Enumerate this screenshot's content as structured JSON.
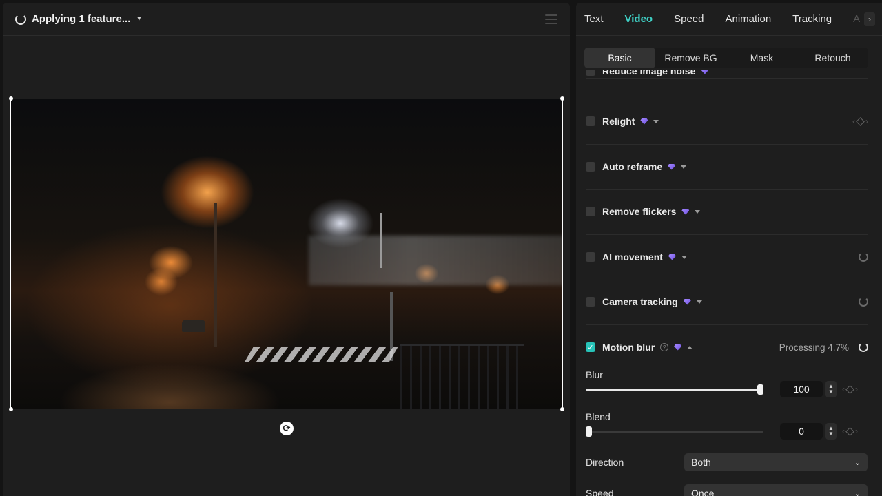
{
  "preview": {
    "status_label": "Applying 1 feature...",
    "icons": {
      "spinner": "loading-spinner-icon",
      "menu": "hamburger-menu-icon",
      "rotate": "rotate-icon"
    }
  },
  "tabs": [
    {
      "label": "Text",
      "active": false
    },
    {
      "label": "Video",
      "active": true
    },
    {
      "label": "Speed",
      "active": false
    },
    {
      "label": "Animation",
      "active": false
    },
    {
      "label": "Tracking",
      "active": false
    },
    {
      "label": "A",
      "active": false
    }
  ],
  "subtabs": [
    {
      "label": "Basic",
      "active": true
    },
    {
      "label": "Remove BG",
      "active": false
    },
    {
      "label": "Mask",
      "active": false
    },
    {
      "label": "Retouch",
      "active": false
    }
  ],
  "features": {
    "cut_off": "Reduce image noise",
    "relight": "Relight",
    "auto_reframe": "Auto reframe",
    "remove_flickers": "Remove flickers",
    "ai_movement": "AI movement",
    "camera_tracking": "Camera tracking",
    "motion_blur": "Motion blur",
    "processing": "Processing 4.7%"
  },
  "motion_blur": {
    "enabled": true,
    "blur": {
      "label": "Blur",
      "value": "100",
      "fraction": 1.0
    },
    "blend": {
      "label": "Blend",
      "value": "0",
      "fraction": 0.0
    },
    "direction": {
      "label": "Direction",
      "selected": "Both"
    },
    "speed": {
      "label": "Speed",
      "selected": "Once"
    }
  },
  "colors": {
    "accent": "#3fd0c5",
    "checkbox_on": "#27c3b8",
    "premium_gem": "#8a6cf0"
  }
}
